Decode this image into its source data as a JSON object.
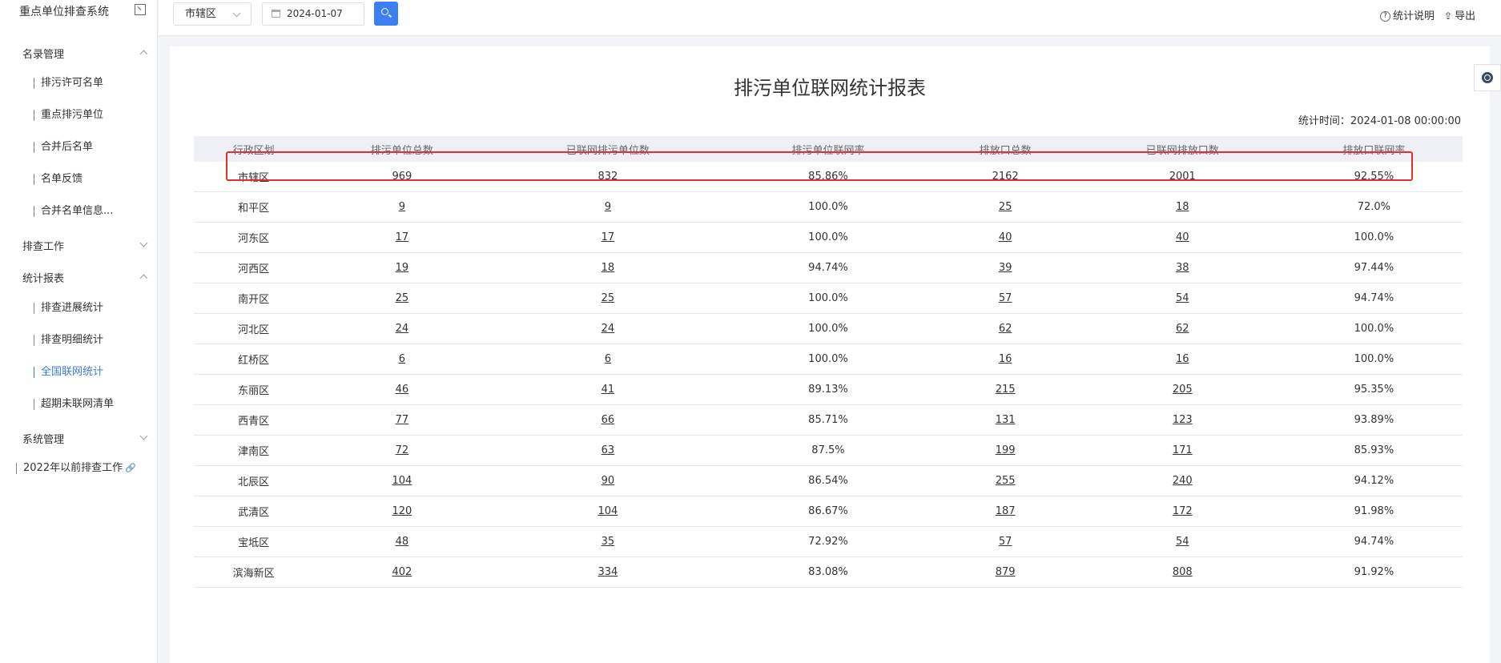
{
  "app": {
    "title": "重点单位排查系统"
  },
  "sidebar": {
    "groups": [
      {
        "label": "名录管理",
        "items": [
          "排污许可名单",
          "重点排污单位",
          "合并后名单",
          "名单反馈",
          "合并名单信息..."
        ]
      },
      {
        "label": "排查工作"
      },
      {
        "label": "统计报表",
        "items": [
          "排查进展统计",
          "排查明细统计",
          "全国联网统计",
          "超期未联网清单"
        ],
        "active": "全国联网统计"
      },
      {
        "label": "系统管理"
      }
    ],
    "legacy_link": "2022年以前排查工作"
  },
  "toolbar": {
    "district_select": "市辖区",
    "date_value": "2024-01-07",
    "help_label": "统计说明",
    "export_label": "导出"
  },
  "report": {
    "title": "排污单位联网统计报表",
    "stat_time": "统计时间：2024-01-08 00:00:00",
    "columns": [
      "行政区划",
      "排污单位总数",
      "已联网排污单位数",
      "排污单位联网率",
      "排放口总数",
      "已联网排放口数",
      "排放口联网率"
    ],
    "rows": [
      [
        "市辖区",
        "969",
        "832",
        "85.86%",
        "2162",
        "2001",
        "92.55%"
      ],
      [
        "和平区",
        "9",
        "9",
        "100.0%",
        "25",
        "18",
        "72.0%"
      ],
      [
        "河东区",
        "17",
        "17",
        "100.0%",
        "40",
        "40",
        "100.0%"
      ],
      [
        "河西区",
        "19",
        "18",
        "94.74%",
        "39",
        "38",
        "97.44%"
      ],
      [
        "南开区",
        "25",
        "25",
        "100.0%",
        "57",
        "54",
        "94.74%"
      ],
      [
        "河北区",
        "24",
        "24",
        "100.0%",
        "62",
        "62",
        "100.0%"
      ],
      [
        "红桥区",
        "6",
        "6",
        "100.0%",
        "16",
        "16",
        "100.0%"
      ],
      [
        "东丽区",
        "46",
        "41",
        "89.13%",
        "215",
        "205",
        "95.35%"
      ],
      [
        "西青区",
        "77",
        "66",
        "85.71%",
        "131",
        "123",
        "93.89%"
      ],
      [
        "津南区",
        "72",
        "63",
        "87.5%",
        "199",
        "171",
        "85.93%"
      ],
      [
        "北辰区",
        "104",
        "90",
        "86.54%",
        "255",
        "240",
        "94.12%"
      ],
      [
        "武清区",
        "120",
        "104",
        "86.67%",
        "187",
        "172",
        "91.98%"
      ],
      [
        "宝坻区",
        "48",
        "35",
        "72.92%",
        "57",
        "54",
        "94.74%"
      ],
      [
        "滨海新区",
        "402",
        "334",
        "83.08%",
        "879",
        "808",
        "91.92%"
      ]
    ]
  },
  "colors": {
    "accent": "#3d7ff2",
    "highlight": "#e23030"
  }
}
